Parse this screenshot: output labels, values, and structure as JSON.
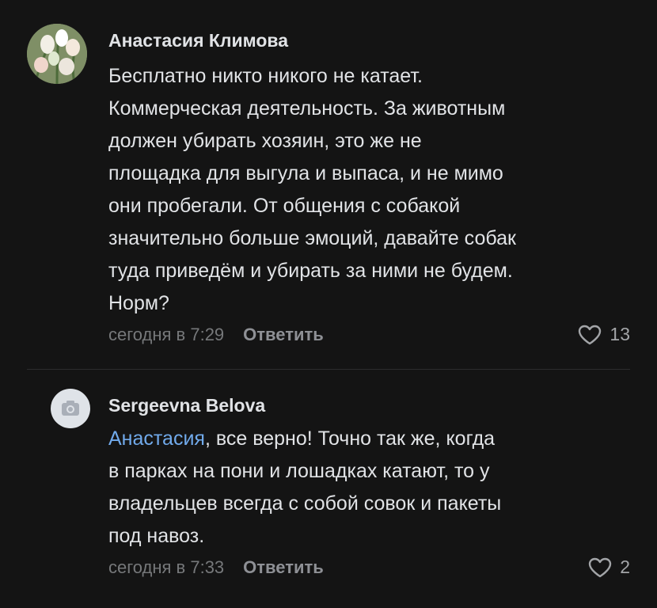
{
  "comments": [
    {
      "author": "Анастасия Климова",
      "lines": [
        "Бесплатно никто никого не катает.",
        "Коммерческая деятельность. За животным",
        "должен убирать хозяин, это же не",
        "площадка для выгула и выпаса, и не мимо",
        "они пробегали. От общения с собакой",
        "значительно больше эмоций, давайте собак",
        "туда приведём и убирать за ними не будем.",
        "Норм?"
      ],
      "time": "сегодня в 7:29",
      "reply": "Ответить",
      "likes": "13",
      "avatar_icon": "tulips-photo"
    },
    {
      "author": "Sergeevna Belova",
      "mention": "Анастасия",
      "first_line_rest": ", все верно! Точно так же, когда",
      "lines": [
        "в парках на пони и лошадках катают, то у",
        "владельцев всегда с собой совок и пакеты",
        "под навоз."
      ],
      "time": "сегодня в 7:33",
      "reply": "Ответить",
      "likes": "2",
      "avatar_icon": "camera-icon"
    }
  ],
  "colors": {
    "background": "#141414",
    "text": "#e1e3e6",
    "secondary": "#76787a",
    "mention": "#71aaeb"
  }
}
